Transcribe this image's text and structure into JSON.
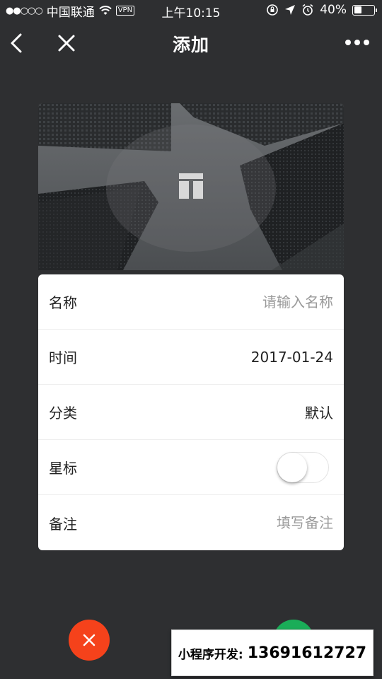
{
  "status_bar": {
    "signal": "●●○○○",
    "carrier": "中国联通",
    "vpn": "VPN",
    "time": "上午10:15",
    "battery": "40%",
    "battery_level": 0.4
  },
  "nav": {
    "title": "添加"
  },
  "form": {
    "name_label": "名称",
    "name_placeholder": "请输入名称",
    "name_value": "",
    "time_label": "时间",
    "time_value": "2017-01-24",
    "category_label": "分类",
    "category_value": "默认",
    "star_label": "星标",
    "star_on": false,
    "note_label": "备注",
    "note_placeholder": "填写备注",
    "note_value": ""
  },
  "buttons": {
    "cancel_color": "#f5421b",
    "confirm_color": "#1aad58",
    "cancel_icon": "close-icon"
  },
  "watermark": {
    "label": "小程序开发:",
    "phone": "13691612727"
  },
  "colors": {
    "background": "#2e2f31",
    "card": "#ffffff",
    "placeholder": "#9a9a9a"
  }
}
